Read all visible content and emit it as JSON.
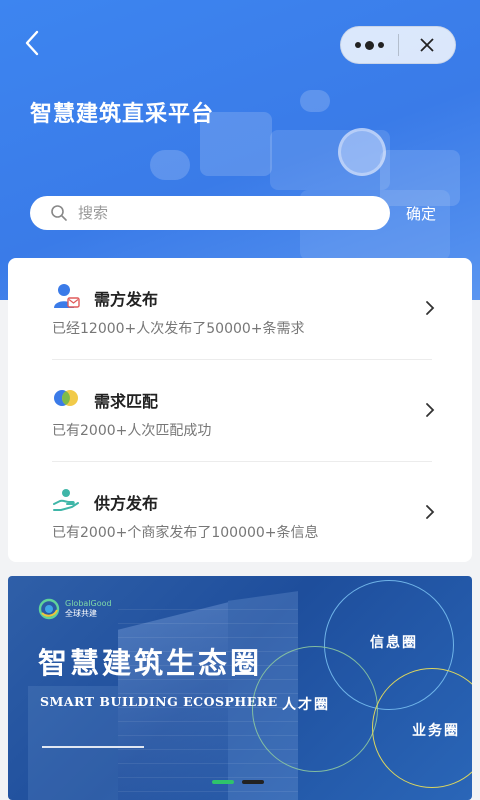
{
  "header": {
    "title": "智慧建筑直采平台"
  },
  "nav": {
    "back_icon": "chevron-left-icon",
    "more_icon": "more-dots-icon",
    "close_icon": "close-icon"
  },
  "search": {
    "placeholder": "搜索",
    "value": "",
    "confirm_label": "确定"
  },
  "list": {
    "items": [
      {
        "icon": "person-publish-icon",
        "title": "需方发布",
        "desc": "已经12000+人次发布了50000+条需求"
      },
      {
        "icon": "match-circles-icon",
        "title": "需求匹配",
        "desc": "已有2000+人次匹配成功"
      },
      {
        "icon": "hand-supply-icon",
        "title": "供方发布",
        "desc": "已有2000+个商家发布了100000+条信息"
      }
    ]
  },
  "banner": {
    "logo_en": "GlobalGood",
    "logo_cn": "全球共建",
    "title": "智慧建筑生态圈",
    "subtitle": "SMART BUILDING ECOSPHERE",
    "circle_labels": [
      "信息圈",
      "人才圈",
      "业务圈"
    ],
    "current_slide": 1,
    "slide_count": 2
  },
  "colors": {
    "header_blue": "#3d85f0",
    "banner_blue": "#1e4e9c",
    "pager_active": "#2fc26b"
  }
}
